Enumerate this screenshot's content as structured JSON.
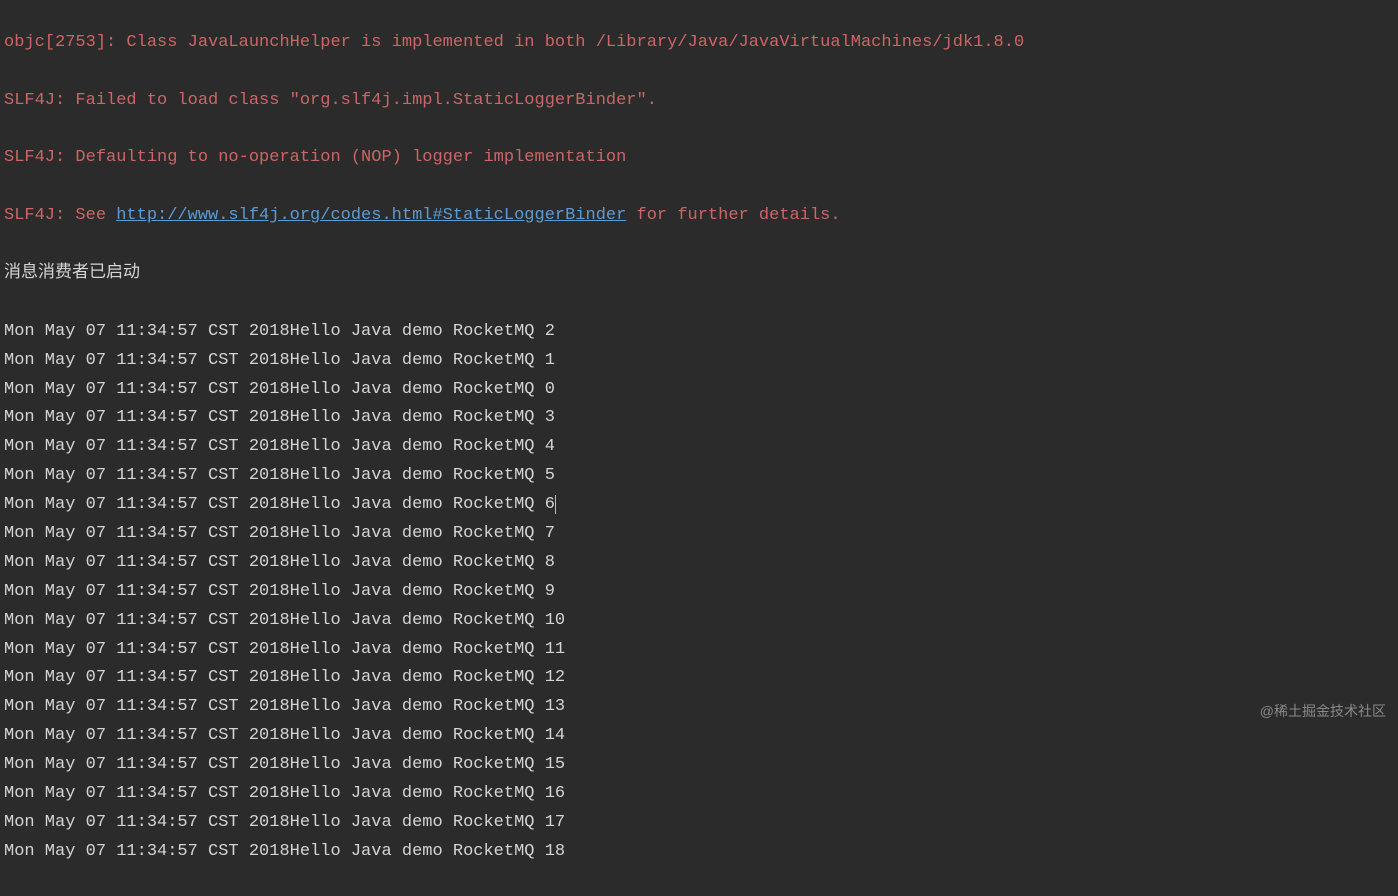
{
  "console": {
    "line1": "objc[2753]: Class JavaLaunchHelper is implemented in both /Library/Java/JavaVirtualMachines/jdk1.8.0",
    "line2": "SLF4J: Failed to load class \"org.slf4j.impl.StaticLoggerBinder\".",
    "line3": "SLF4J: Defaulting to no-operation (NOP) logger implementation",
    "line4_prefix": "SLF4J: See ",
    "line4_link": "http://www.slf4j.org/codes.html#StaticLoggerBinder",
    "line4_suffix": " for further details.",
    "status": "消息消费者已启动",
    "timestamp": "Mon May 07 11:34:57 CST 2018",
    "msg_prefix": "Hello Java demo RocketMQ ",
    "msg_numbers": [
      "2",
      "1",
      "0",
      "3",
      "4",
      "5",
      "6",
      "7",
      "8",
      "9",
      "10",
      "11",
      "12",
      "13",
      "14",
      "15",
      "16",
      "17",
      "18"
    ]
  },
  "watermark": "@稀土掘金技术社区"
}
